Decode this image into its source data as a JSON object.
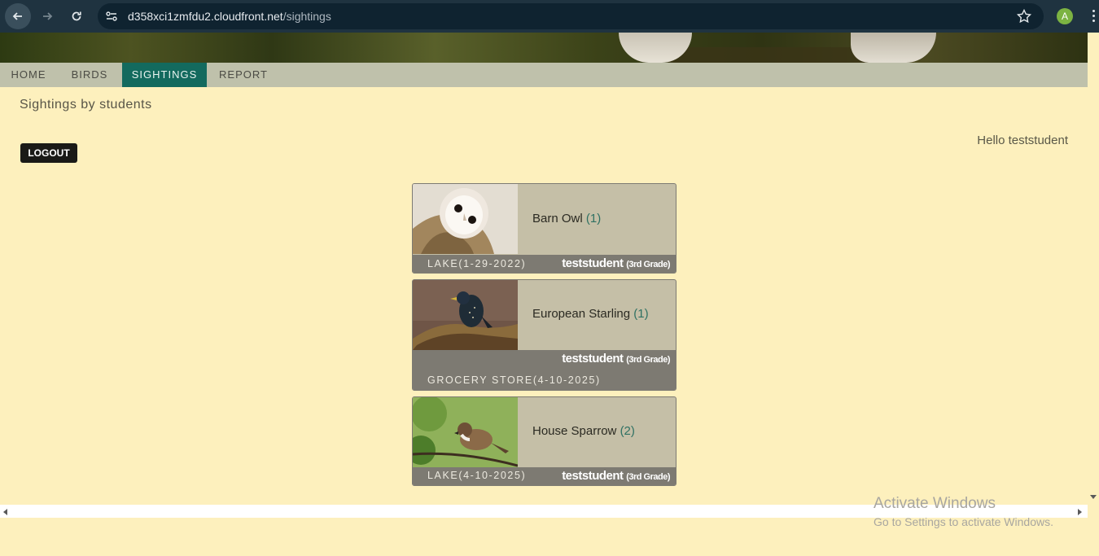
{
  "browser": {
    "url_host": "d358xci1zmfdu2.cloudfront.net",
    "url_path": "/sightings",
    "profile_initial": "A"
  },
  "menu": {
    "items": [
      {
        "label": "HOME"
      },
      {
        "label": "BIRDS"
      },
      {
        "label": "SIGHTINGS",
        "active": true
      },
      {
        "label": "REPORT"
      }
    ]
  },
  "page": {
    "title": "Sightings by students",
    "logout_label": "LOGOUT",
    "greeting": "Hello teststudent"
  },
  "sightings": [
    {
      "bird": "Barn Owl",
      "count": "(1)",
      "location": "LAKE(1-29-2022)",
      "student": "teststudent",
      "grade": "(3rd Grade)"
    },
    {
      "bird": "European Starling",
      "count": "(1)",
      "location": "GROCERY STORE(4-10-2025)",
      "student": "teststudent",
      "grade": "(3rd Grade)"
    },
    {
      "bird": "House Sparrow",
      "count": "(2)",
      "location": "LAKE(4-10-2025)",
      "student": "teststudent",
      "grade": "(3rd Grade)"
    }
  ],
  "watermark": {
    "line1": "Activate Windows",
    "line2": "Go to Settings to activate Windows."
  },
  "colors": {
    "page_bg": "#fdf0bd",
    "menu_bg": "#bfc1ab",
    "menu_active": "#136a5e",
    "card_bg": "#c5bfa7",
    "card_footer": "#7d7a72"
  }
}
